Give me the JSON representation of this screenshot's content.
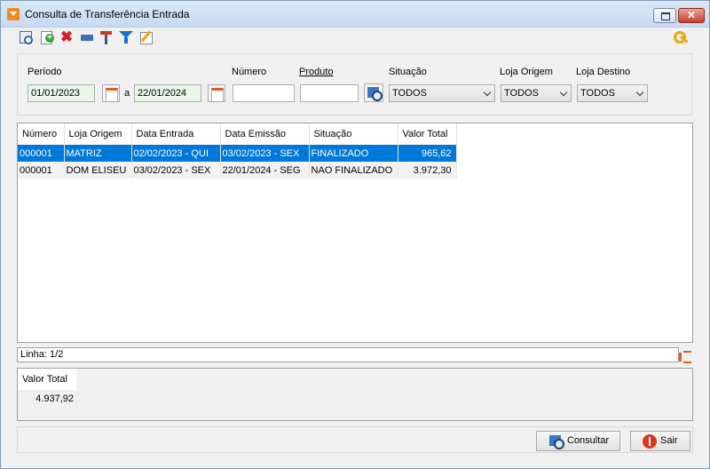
{
  "window": {
    "title": "Consulta de Transferência Entrada",
    "close_glyph": "✕"
  },
  "toolbar": {
    "icons": [
      "search-icon",
      "add-icon",
      "delete-icon",
      "print-icon",
      "tools-icon",
      "filter-icon",
      "edit-icon",
      "key-icon"
    ],
    "delete_glyph": "✖"
  },
  "filters": {
    "periodo_label": "Período",
    "date_from": "01/01/2023",
    "date_sep": "a",
    "date_to": "22/01/2024",
    "numero_label": "Número",
    "numero_value": "",
    "produto_label": "Produto",
    "produto_value": "",
    "situacao_label": "Situação",
    "situacao_value": "TODOS",
    "loja_origem_label": "Loja Origem",
    "loja_origem_value": "TODOS",
    "loja_destino_label": "Loja Destino",
    "loja_destino_value": "TODOS"
  },
  "grid": {
    "columns": [
      "Número",
      "Loja Origem",
      "Data Entrada",
      "Data Emissão",
      "Situação",
      "Valor Total"
    ],
    "rows": [
      {
        "numero": "000001",
        "loja_origem": "MATRIZ",
        "data_entrada": "02/02/2023 - QUI",
        "data_emissao": "03/02/2023 - SEX",
        "situacao": "FINALIZADO",
        "valor_total": "965,62",
        "selected": true
      },
      {
        "numero": "000001",
        "loja_origem": "DOM ELISEU",
        "data_entrada": "03/02/2023 - SEX",
        "data_emissao": "22/01/2024 - SEG",
        "situacao": "NAO FINALIZADO",
        "valor_total": "3.972,30",
        "selected": false
      }
    ]
  },
  "status": {
    "linha": "Linha: 1/2"
  },
  "totals": {
    "label": "Valor Total",
    "value": "4.937,92"
  },
  "buttons": {
    "consultar": "Consultar",
    "sair": "Sair"
  },
  "colors": {
    "selection": "#0078d7",
    "accent": "#f08a24",
    "close": "#c7412b"
  }
}
